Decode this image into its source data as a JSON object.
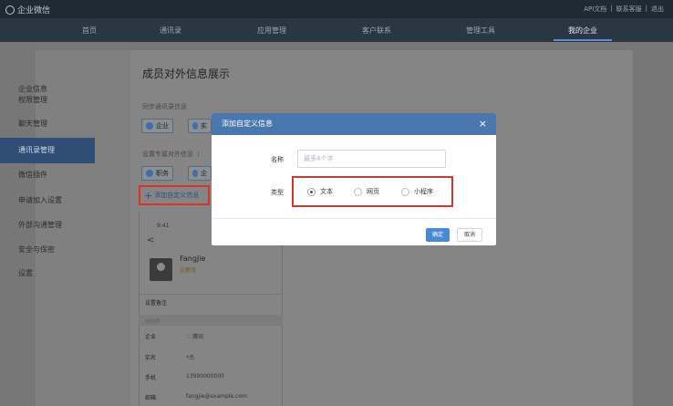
{
  "topbar": {
    "app_name": "企业微信",
    "links": [
      "API文档",
      "|",
      "联系客服",
      "|",
      "退出"
    ]
  },
  "nav": {
    "items": [
      "首页",
      "通讯录",
      "应用管理",
      "客户联系",
      "管理工具",
      "我的企业"
    ],
    "active": "我的企业"
  },
  "sidebar": {
    "items": [
      "企业信息",
      "权限管理",
      "聊天管理",
      "通讯录管理",
      "微信插件",
      "申请加入设置",
      "外部沟通管理",
      "安全与保密",
      "设置"
    ],
    "active": "通讯录管理"
  },
  "main": {
    "title": "成员对外信息展示",
    "sync_label": "同步通讯录信息",
    "sync_chips": [
      "企业",
      "实"
    ],
    "set_label": "设置专属对外信息（",
    "set_chips": [
      "职务",
      "企"
    ],
    "add_custom": "添加自定义信息"
  },
  "phone_preview": {
    "time": "9:41",
    "name": "FangJie",
    "corp": "企鹅讯",
    "set_remark": "设置备注",
    "section_title": "企业信息",
    "rows": [
      {
        "label": "企业",
        "value": "♡ 腾讯"
      },
      {
        "label": "实名",
        "value": "*杰"
      },
      {
        "label": "手机",
        "value": "13900000000"
      },
      {
        "label": "邮箱",
        "value": "fangjie@example.com"
      }
    ]
  },
  "modal": {
    "title": "添加自定义信息",
    "close": "×",
    "name_label": "名称",
    "name_placeholder": "最多4个字",
    "type_label": "类型",
    "types": [
      "文本",
      "网页",
      "小程序"
    ],
    "selected_type": "文本",
    "ok": "确定",
    "cancel": "取消"
  },
  "colors": {
    "accent": "#4a78ad",
    "highlight": "#d9342b",
    "sidebar_active": "#304d75"
  }
}
